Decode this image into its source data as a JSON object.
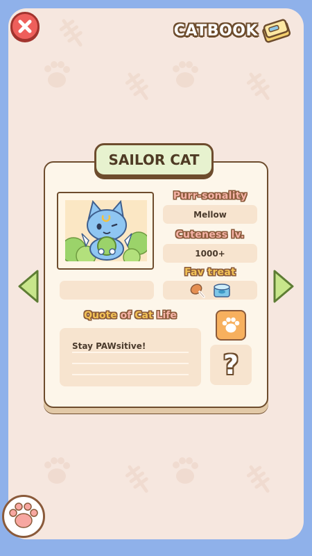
{
  "header": {
    "title": "CATBOOK",
    "close_icon": "close-x-icon",
    "book_icon": "book-icon"
  },
  "card": {
    "name": "SAILOR CAT",
    "personality_label": "Purr-sonality",
    "personality_value": "Mellow",
    "cuteness_label": "Cuteness lv.",
    "cuteness_value": "1000+",
    "fav_treat_label": "Fav treat",
    "fav_treat_icons": [
      "drumstick-icon",
      "fish-can-icon"
    ],
    "quote_title_parts": [
      "Quote",
      "of",
      "Cat",
      "Life"
    ],
    "quote_text": "Stay PAWsitive!",
    "question_mark": "?"
  },
  "nav": {
    "prev_icon": "arrow-left-icon",
    "next_icon": "arrow-right-icon"
  },
  "colors": {
    "outer_bg": "#8fb1ea",
    "panel_bg": "#f6e7df",
    "card_bg": "#fdf6ea",
    "outline": "#6d4c2d",
    "name_badge": "#e7f2cf",
    "stat_box": "#f7e4cf",
    "accent_orange": "#f7b05e",
    "label_pink": "#f5b2a6",
    "label_gold": "#f3c256",
    "close_red": "#ee5f5b",
    "arrow_green": "#c8e68b"
  }
}
